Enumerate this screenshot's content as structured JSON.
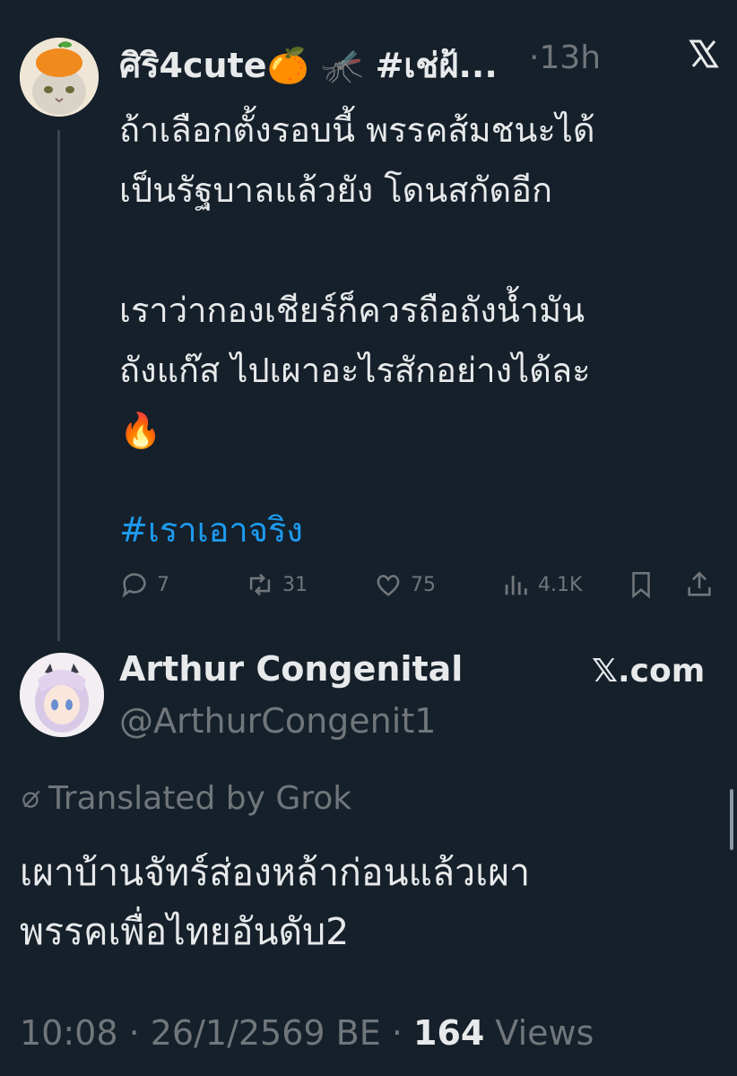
{
  "tweet": {
    "display_name": "ศิริ4cute🍊 🦟 #เช่ฝ้...",
    "separator": "·",
    "time": "13h",
    "body": "ถ้าเลือกตั้งรอบนี้ พรรคส้มชนะได้\nเป็นรัฐบาลแล้วยัง โดนสกัดอีก\n\nเราว่ากองเชียร์ก็ควรถือถังน้ำมัน\nถังแก๊ส ไปเผาอะไรสักอย่างได้ละ\n🔥",
    "hashtag": "#เราเอาจริง",
    "actions": {
      "replies": "7",
      "retweets": "31",
      "likes": "75",
      "views": "4.1K"
    },
    "icons": [
      "comment-icon",
      "retweet-icon",
      "heart-icon",
      "views-icon",
      "bookmark-icon",
      "share-icon",
      "x-logo-icon"
    ]
  },
  "quoted": {
    "display_name": "Arthur Congenital",
    "handle": "@ArthurCongenit1",
    "source": "𝕏.com",
    "translated_label": "Translated by Grok",
    "body": "เผาบ้านจัทร์ส่องหล้าก่อนแล้วเผา\nพรรคเพื่อไทยอันดับ2",
    "timestamp": "10:08 · 26/1/2569 BE · ",
    "views_count": "164",
    "views_label": " Views"
  },
  "colors": {
    "background": "#15202b",
    "text": "#e7e9ea",
    "muted": "#71767b",
    "accent": "#1d9bf0"
  }
}
